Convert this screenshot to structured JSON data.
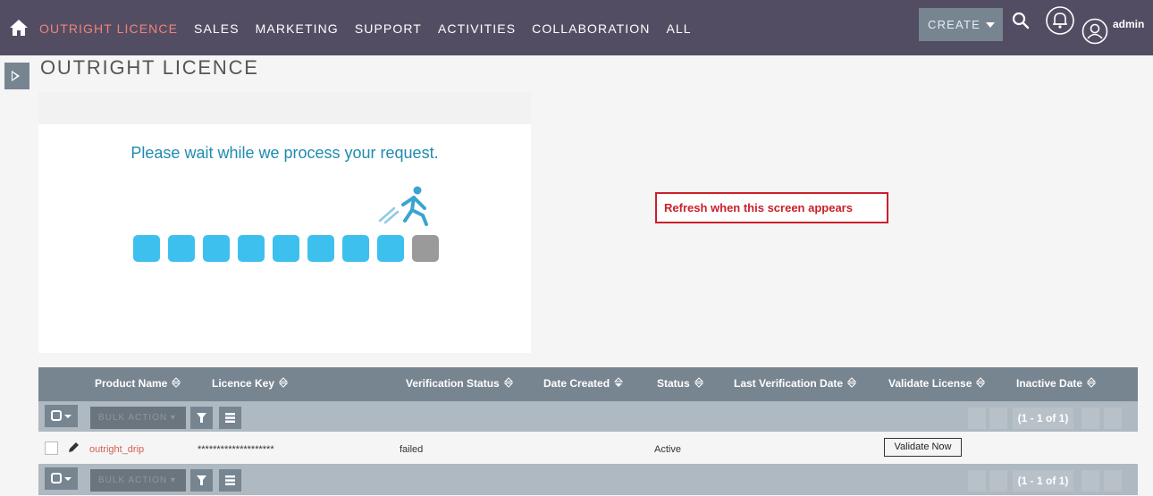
{
  "nav": {
    "items": [
      {
        "label": "OUTRIGHT LICENCE",
        "active": true
      },
      {
        "label": "SALES"
      },
      {
        "label": "MARKETING"
      },
      {
        "label": "SUPPORT"
      },
      {
        "label": "ACTIVITIES"
      },
      {
        "label": "COLLABORATION"
      },
      {
        "label": "ALL"
      }
    ],
    "create_label": "CREATE",
    "user_label": "admin"
  },
  "page": {
    "title": "OUTRIGHT LICENCE"
  },
  "loading": {
    "message": "Please wait while we process your request.",
    "progress_steps_done": 8,
    "progress_steps_total": 9
  },
  "note": {
    "text": "Refresh when this screen appears"
  },
  "table": {
    "columns": [
      "Product Name",
      "Licence Key",
      "Verification Status",
      "Date Created",
      "Status",
      "Last Verification Date",
      "Validate License",
      "Inactive Date"
    ],
    "bulk_action_label": "BULK ACTION",
    "pagination_label": "(1 - 1 of 1)",
    "rows": [
      {
        "product_name": "outright_drip",
        "licence_key": "********************",
        "verification_status": "failed",
        "date_created": "",
        "status": "Active",
        "last_verification_date": "",
        "validate_label": "Validate Now",
        "inactive_date": ""
      }
    ]
  },
  "colors": {
    "nav_bg": "#534d64",
    "active_nav": "#f08377",
    "table_header_bg": "#778591",
    "progress_done": "#3ec0ef",
    "progress_pending": "#9a9a9a",
    "note_red": "#cc1f2a"
  }
}
